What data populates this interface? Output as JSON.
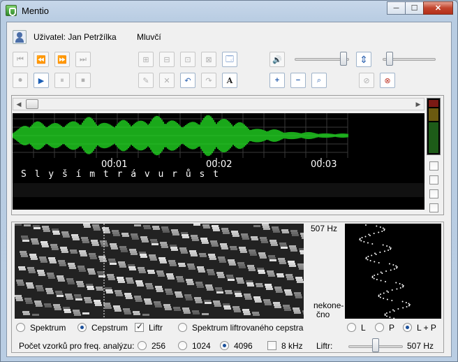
{
  "window": {
    "title": "Mentio",
    "minimize": "─",
    "maximize": "☐",
    "close": "✕"
  },
  "header": {
    "user_label": "Uživatel: Jan Petržílka",
    "speaker_label": "Mluvčí"
  },
  "toolbar": {
    "transport_top": [
      "⏮",
      "⏪",
      "⏩",
      "⏭"
    ],
    "transport_bottom": [
      "⏺",
      "▶",
      "⏸",
      "⏹"
    ],
    "edit_top": [
      "⊞",
      "⊟",
      "⊡",
      "⊠",
      "🗔"
    ],
    "edit_bottom": [
      "✎",
      "✕",
      "↶",
      "↷",
      "A"
    ],
    "volume_icon": "🔊",
    "zoom_in": "+",
    "zoom_out": "−",
    "zoom_fit": "⌕",
    "swap_icon": "⇕",
    "aux1": "⊘",
    "aux2": "⊗"
  },
  "levels": {
    "volume_level": 0.93,
    "right_slider_level": 0.07
  },
  "waveform": {
    "time_ticks": [
      "00:01",
      "00:02",
      "00:03"
    ],
    "transcript": "S l y š í m   t r á v u r ů s   t"
  },
  "spectrogram": {
    "top_freq": "507 Hz",
    "bottom_label_1": "nekone-",
    "bottom_label_2": "čno"
  },
  "analysis_options": {
    "spektrum": "Spektrum",
    "cepstrum": "Cepstrum",
    "liftr_check": "Liftr",
    "spektrum_lift": "Spektrum liftrovaného cepstra",
    "selected": "Cepstrum"
  },
  "channel": {
    "l": "L",
    "p": "P",
    "lp": "L + P",
    "selected": "L + P"
  },
  "samples": {
    "label": "Počet vzorků pro freq. analýzu:",
    "options": [
      "256",
      "1024",
      "4096"
    ],
    "selected": "4096",
    "khz": "8 kHz",
    "liftr_label": "Liftr:",
    "liftr_value": "507 Hz",
    "liftr_level": 0.5
  },
  "colors": {
    "wave": "#22e022",
    "accent": "#1c5fb6"
  }
}
